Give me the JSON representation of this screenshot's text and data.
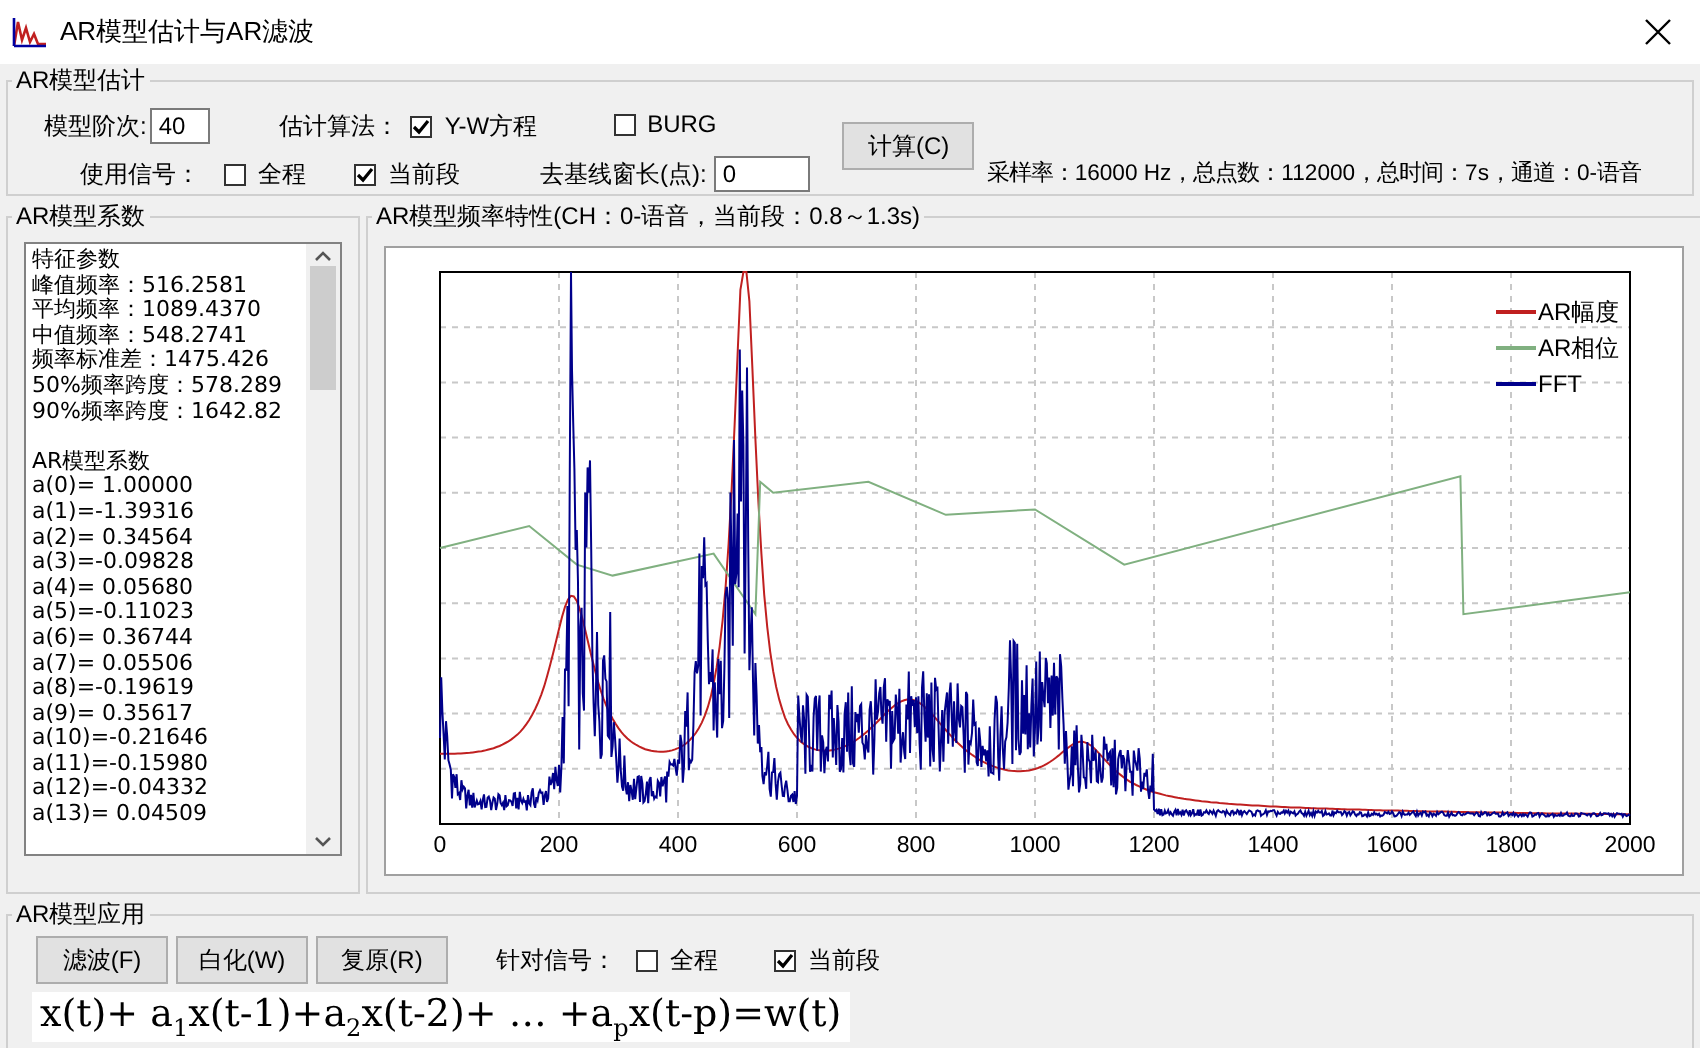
{
  "window": {
    "title": "AR模型估计与AR滤波"
  },
  "estimation": {
    "title": "AR模型估计",
    "order": {
      "label": "模型阶次:",
      "value": "40"
    },
    "algorithm": {
      "label": "估计算法：",
      "options": [
        {
          "label": "Y-W方程",
          "checked": true
        },
        {
          "label": "BURG",
          "checked": false
        }
      ]
    },
    "signal": {
      "label": "使用信号：",
      "options": [
        {
          "label": "全程",
          "checked": false
        },
        {
          "label": "当前段",
          "checked": true
        }
      ]
    },
    "baseline": {
      "label": "去基线窗长(点):",
      "value": "0"
    },
    "compute_button": "计算(C)",
    "info": "采样率：16000 Hz，总点数：112000，总时间：7s，通道：0-语音"
  },
  "coefficients": {
    "title": "AR模型系数",
    "sections": [
      {
        "title": "特征参数",
        "lines": [
          "峰值频率：516.2581",
          "平均频率：1089.4370",
          "中值频率：548.2741",
          "频率标准差：1475.426",
          "50%频率跨度：578.289",
          "90%频率跨度：1642.82"
        ]
      },
      {
        "title": "AR模型系数",
        "lines": [
          "a(0)= 1.00000",
          "a(1)=-1.39316",
          "a(2)= 0.34564",
          "a(3)=-0.09828",
          "a(4)= 0.05680",
          "a(5)=-0.11023",
          "a(6)= 0.36744",
          "a(7)= 0.05506",
          "a(8)=-0.19619",
          "a(9)= 0.35617",
          "a(10)=-0.21646",
          "a(11)=-0.15980",
          "a(12)=-0.04332",
          "a(13)= 0.04509"
        ]
      }
    ]
  },
  "frequency_response": {
    "title": "AR模型频率特性(CH：0-语音，当前段：0.8～1.3s)",
    "xticks": [
      "0",
      "200",
      "400",
      "600",
      "800",
      "1000",
      "1200",
      "1400",
      "1600",
      "1800",
      "2000"
    ],
    "series": [
      {
        "name": "AR幅度",
        "color": "#c02020",
        "kind": "ar_magnitude"
      },
      {
        "name": "AR相位",
        "color": "#80b080",
        "kind": "ar_phase"
      },
      {
        "name": "FFT",
        "color": "#00008b",
        "kind": "fft"
      }
    ]
  },
  "application": {
    "title": "AR模型应用",
    "buttons": [
      "滤波(F)",
      "白化(W)",
      "复原(R)"
    ],
    "signal": {
      "label": "针对信号：",
      "options": [
        {
          "label": "全程",
          "checked": false
        },
        {
          "label": "当前段",
          "checked": true
        }
      ]
    },
    "formula": "x(t)+ a$_{1}$x(t-1)+a$_{2}$x(t-2)+ … +a$_{p}$x(t-p)=w(t)"
  }
}
